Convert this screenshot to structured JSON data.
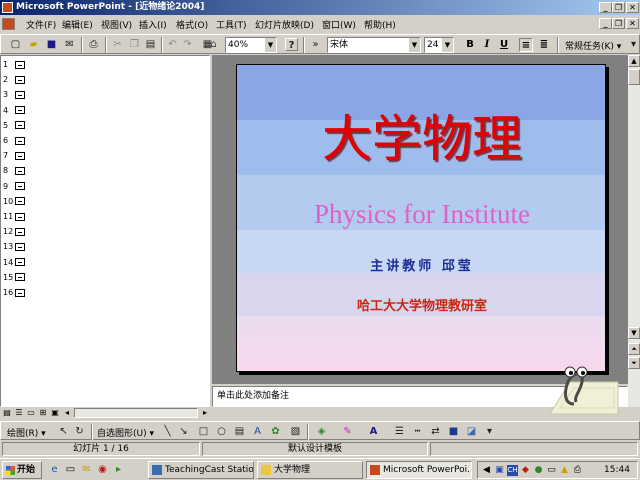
{
  "window": {
    "title": "Microsoft PowerPoint - [近物绪论2004]",
    "minimize": "_",
    "restore": "❐",
    "close": "✕",
    "doc_minimize": "_",
    "doc_restore": "❐",
    "doc_close": "✕"
  },
  "menu": [
    "文件(F)",
    "编辑(E)",
    "视图(V)",
    "插入(I)",
    "格式(O)",
    "工具(T)",
    "幻灯片放映(D)",
    "窗口(W)",
    "帮助(H)"
  ],
  "toolbar": {
    "zoom": "40%",
    "help_label": "?",
    "font": "宋体",
    "font_size": "24",
    "bold": "B",
    "italic": "I",
    "underline": "U",
    "common_tasks": "常规任务(K)"
  },
  "outline": {
    "slides": [
      "1",
      "2",
      "3",
      "4",
      "5",
      "6",
      "7",
      "8",
      "9",
      "10",
      "11",
      "12",
      "13",
      "14",
      "15",
      "16"
    ]
  },
  "slide": {
    "title": "大学物理",
    "subtitle": "Physics for Institute",
    "teacher": "主讲教师    邱莹",
    "department": "哈工大大学物理教研室"
  },
  "notes": {
    "placeholder": "单击此处添加备注"
  },
  "drawing_toolbar": {
    "draw_label": "绘图(R)",
    "autoshapes_label": "自选图形(U)"
  },
  "statusbar": {
    "slide_position": "幻灯片 1 / 16",
    "template": "默认设计模板"
  },
  "taskbar": {
    "start": "开始",
    "tasks": [
      "TeachingCast Station",
      "大学物理",
      "Microsoft PowerPoi..."
    ],
    "clock": "15:44"
  },
  "colors": {
    "title_bar": "#0a246a",
    "slide_title": "#e20000",
    "slide_subtitle": "#e060c8",
    "slide_teacher": "#1c2e96",
    "slide_department": "#c82814"
  }
}
